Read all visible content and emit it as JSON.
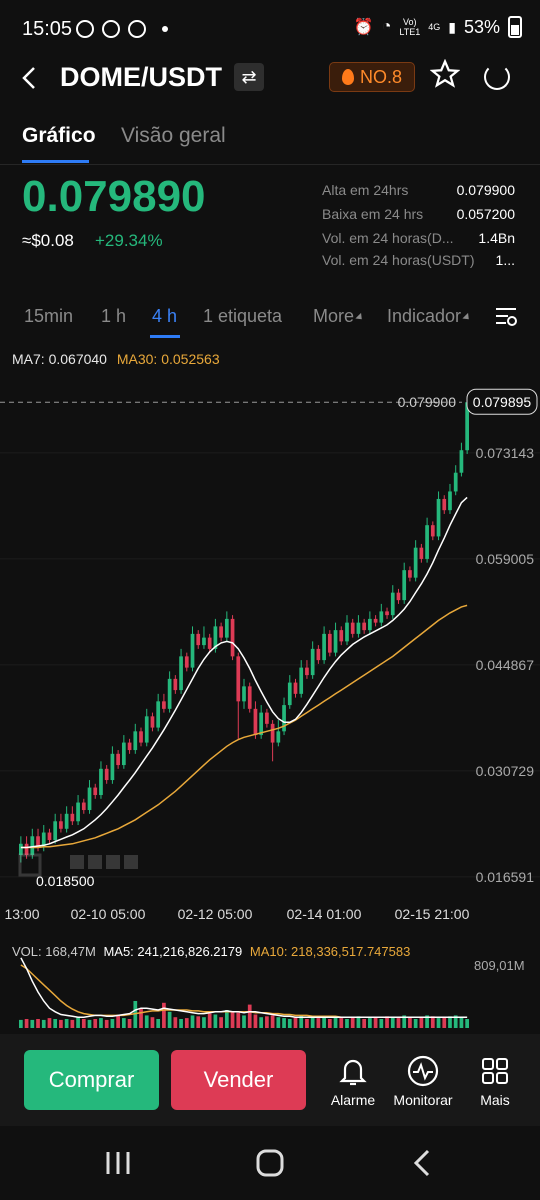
{
  "status": {
    "time": "15:05",
    "net_label_top": "Vo)",
    "net_label_bottom": "LTE1",
    "net_type": "4G",
    "battery": "53%"
  },
  "header": {
    "title": "DOME/USDT",
    "swap_icon": "swap-icon",
    "rank": "NO.8",
    "star_icon": "star-icon",
    "share_icon": "share-icon"
  },
  "tabs": [
    {
      "label": "Gráfico",
      "active": true
    },
    {
      "label": "Visão geral",
      "active": false
    }
  ],
  "price": {
    "last": "0.079890",
    "approx": "≈$0.08",
    "change": "+29.34%"
  },
  "stats": [
    {
      "label": "Alta em 24hrs",
      "value": "0.079900"
    },
    {
      "label": "Baixa em 24 hrs",
      "value": "0.057200"
    },
    {
      "label": "Vol. em 24 horas(D...",
      "value": "1.4Bn"
    },
    {
      "label": "Vol. em 24 horas(USDT)",
      "value": "1..."
    }
  ],
  "intervals": [
    {
      "label": "15min",
      "active": false
    },
    {
      "label": "1 h",
      "active": false
    },
    {
      "label": "4 h",
      "active": true
    },
    {
      "label": "1 etiqueta",
      "active": false
    },
    {
      "label": "More",
      "active": false
    },
    {
      "label": "Indicador",
      "active": false
    }
  ],
  "ma": {
    "ma7": "MA7: 0.067040",
    "ma30": "MA30: 0.052563"
  },
  "colors": {
    "up": "#25b87c",
    "down": "#dd3b55",
    "accent": "#2e7cf6",
    "ma7": "#ffffff",
    "ma30": "#e8a83a"
  },
  "chart_data": {
    "type": "candlestick",
    "y_ticks": [
      "0.073143",
      "0.059005",
      "0.044867",
      "0.030729",
      "0.016591"
    ],
    "x_ticks": [
      "13:00",
      "02-10 05:00",
      "02-12 05:00",
      "02-14 01:00",
      "02-15 21:00"
    ],
    "high_label": "0.079900",
    "low_label": "0.018500",
    "last_label": "0.079895",
    "ylim": [
      0.0155,
      0.081
    ],
    "candles": [
      [
        0.0195,
        0.021,
        0.022,
        0.0185
      ],
      [
        0.021,
        0.0195,
        0.022,
        0.019
      ],
      [
        0.0195,
        0.022,
        0.023,
        0.019
      ],
      [
        0.022,
        0.0205,
        0.023,
        0.02
      ],
      [
        0.0205,
        0.0225,
        0.0235,
        0.02
      ],
      [
        0.0225,
        0.0215,
        0.023,
        0.021
      ],
      [
        0.0215,
        0.024,
        0.025,
        0.021
      ],
      [
        0.024,
        0.023,
        0.025,
        0.0225
      ],
      [
        0.023,
        0.025,
        0.026,
        0.0225
      ],
      [
        0.025,
        0.024,
        0.026,
        0.0235
      ],
      [
        0.024,
        0.0265,
        0.0275,
        0.0235
      ],
      [
        0.0265,
        0.0255,
        0.027,
        0.025
      ],
      [
        0.0255,
        0.0285,
        0.0295,
        0.025
      ],
      [
        0.0285,
        0.0275,
        0.029,
        0.027
      ],
      [
        0.0275,
        0.031,
        0.032,
        0.027
      ],
      [
        0.031,
        0.0295,
        0.0315,
        0.029
      ],
      [
        0.0295,
        0.033,
        0.034,
        0.029
      ],
      [
        0.033,
        0.0315,
        0.0335,
        0.031
      ],
      [
        0.0315,
        0.0345,
        0.0355,
        0.031
      ],
      [
        0.0345,
        0.0335,
        0.035,
        0.033
      ],
      [
        0.0335,
        0.036,
        0.037,
        0.033
      ],
      [
        0.036,
        0.0345,
        0.0365,
        0.034
      ],
      [
        0.0345,
        0.038,
        0.039,
        0.034
      ],
      [
        0.038,
        0.0365,
        0.0385,
        0.036
      ],
      [
        0.0365,
        0.04,
        0.041,
        0.036
      ],
      [
        0.04,
        0.039,
        0.041,
        0.0385
      ],
      [
        0.039,
        0.043,
        0.044,
        0.0385
      ],
      [
        0.043,
        0.0415,
        0.0435,
        0.041
      ],
      [
        0.0415,
        0.046,
        0.047,
        0.041
      ],
      [
        0.046,
        0.0445,
        0.0465,
        0.044
      ],
      [
        0.0445,
        0.049,
        0.05,
        0.044
      ],
      [
        0.049,
        0.0475,
        0.0495,
        0.047
      ],
      [
        0.0475,
        0.0485,
        0.05,
        0.047
      ],
      [
        0.0485,
        0.047,
        0.049,
        0.0465
      ],
      [
        0.047,
        0.05,
        0.051,
        0.0465
      ],
      [
        0.05,
        0.0485,
        0.0505,
        0.048
      ],
      [
        0.0485,
        0.051,
        0.052,
        0.048
      ],
      [
        0.051,
        0.046,
        0.0515,
        0.0455
      ],
      [
        0.046,
        0.04,
        0.0465,
        0.035
      ],
      [
        0.04,
        0.042,
        0.043,
        0.039
      ],
      [
        0.042,
        0.039,
        0.0425,
        0.0385
      ],
      [
        0.039,
        0.0355,
        0.04,
        0.035
      ],
      [
        0.0355,
        0.0385,
        0.0395,
        0.035
      ],
      [
        0.0385,
        0.037,
        0.039,
        0.0365
      ],
      [
        0.037,
        0.0345,
        0.0375,
        0.032
      ],
      [
        0.0345,
        0.036,
        0.0375,
        0.034
      ],
      [
        0.036,
        0.0395,
        0.0405,
        0.0355
      ],
      [
        0.0395,
        0.0425,
        0.0435,
        0.039
      ],
      [
        0.0425,
        0.041,
        0.043,
        0.0405
      ],
      [
        0.041,
        0.0445,
        0.0455,
        0.0405
      ],
      [
        0.0445,
        0.0435,
        0.0455,
        0.043
      ],
      [
        0.0435,
        0.047,
        0.048,
        0.043
      ],
      [
        0.047,
        0.0455,
        0.0475,
        0.045
      ],
      [
        0.0455,
        0.049,
        0.05,
        0.045
      ],
      [
        0.049,
        0.0465,
        0.0495,
        0.046
      ],
      [
        0.0465,
        0.0495,
        0.0505,
        0.046
      ],
      [
        0.0495,
        0.048,
        0.05,
        0.0475
      ],
      [
        0.048,
        0.0505,
        0.0515,
        0.0475
      ],
      [
        0.0505,
        0.049,
        0.051,
        0.0485
      ],
      [
        0.049,
        0.0505,
        0.0515,
        0.0485
      ],
      [
        0.0505,
        0.0495,
        0.051,
        0.049
      ],
      [
        0.0495,
        0.051,
        0.052,
        0.049
      ],
      [
        0.051,
        0.0505,
        0.0515,
        0.05
      ],
      [
        0.0505,
        0.052,
        0.053,
        0.05
      ],
      [
        0.052,
        0.0515,
        0.0525,
        0.051
      ],
      [
        0.0515,
        0.0545,
        0.0555,
        0.051
      ],
      [
        0.0545,
        0.0535,
        0.055,
        0.053
      ],
      [
        0.0535,
        0.0575,
        0.0585,
        0.053
      ],
      [
        0.0575,
        0.0565,
        0.058,
        0.056
      ],
      [
        0.0565,
        0.0605,
        0.0615,
        0.056
      ],
      [
        0.0605,
        0.059,
        0.061,
        0.0585
      ],
      [
        0.059,
        0.0635,
        0.0645,
        0.0585
      ],
      [
        0.0635,
        0.062,
        0.064,
        0.0615
      ],
      [
        0.062,
        0.067,
        0.068,
        0.0615
      ],
      [
        0.067,
        0.0655,
        0.0675,
        0.065
      ],
      [
        0.0655,
        0.068,
        0.069,
        0.065
      ],
      [
        0.068,
        0.0705,
        0.0715,
        0.0675
      ],
      [
        0.0705,
        0.0735,
        0.0745,
        0.07
      ],
      [
        0.0735,
        0.0799,
        0.0799,
        0.073
      ]
    ],
    "ma7": [
      0.0205,
      0.0205,
      0.0206,
      0.0207,
      0.0208,
      0.021,
      0.0213,
      0.0216,
      0.0219,
      0.0222,
      0.0226,
      0.023,
      0.0236,
      0.0242,
      0.0249,
      0.0257,
      0.0266,
      0.0275,
      0.0285,
      0.0295,
      0.0305,
      0.0316,
      0.0327,
      0.0338,
      0.035,
      0.0362,
      0.0375,
      0.0388,
      0.0402,
      0.0416,
      0.043,
      0.0444,
      0.0456,
      0.0466,
      0.0473,
      0.0478,
      0.048,
      0.0478,
      0.047,
      0.0458,
      0.0444,
      0.0428,
      0.0413,
      0.0399,
      0.0386,
      0.0377,
      0.0372,
      0.0372,
      0.0376,
      0.0385,
      0.0396,
      0.0408,
      0.042,
      0.0432,
      0.0443,
      0.0453,
      0.0462,
      0.0469,
      0.0476,
      0.0481,
      0.0486,
      0.049,
      0.0494,
      0.0498,
      0.0502,
      0.0508,
      0.0515,
      0.0523,
      0.0533,
      0.0545,
      0.0557,
      0.057,
      0.0585,
      0.0602,
      0.0618,
      0.0635,
      0.065,
      0.0665,
      0.0672
    ],
    "ma30": [
      0.0205,
      0.0205,
      0.0205,
      0.0205,
      0.0206,
      0.0206,
      0.0207,
      0.0208,
      0.0209,
      0.021,
      0.0212,
      0.0214,
      0.0216,
      0.0218,
      0.0221,
      0.0224,
      0.0227,
      0.023,
      0.0234,
      0.0238,
      0.0242,
      0.0247,
      0.0252,
      0.0257,
      0.0262,
      0.0268,
      0.0274,
      0.028,
      0.0287,
      0.0294,
      0.0301,
      0.0308,
      0.0315,
      0.0322,
      0.0328,
      0.0334,
      0.034,
      0.0345,
      0.0349,
      0.0352,
      0.0354,
      0.0356,
      0.0358,
      0.036,
      0.0362,
      0.0364,
      0.0367,
      0.0371,
      0.0375,
      0.038,
      0.0385,
      0.039,
      0.0395,
      0.04,
      0.0405,
      0.041,
      0.0415,
      0.042,
      0.0425,
      0.043,
      0.0435,
      0.044,
      0.0445,
      0.045,
      0.0455,
      0.046,
      0.0466,
      0.0472,
      0.0478,
      0.0484,
      0.049,
      0.0496,
      0.0502,
      0.0508,
      0.0513,
      0.0518,
      0.0522,
      0.0526,
      0.0528
    ]
  },
  "volume": {
    "vol": "VOL: 168,47M",
    "ma5": "MA5: 241,216,826.2179",
    "ma10": "MA10: 218,336,517.747583",
    "max_label": "809,01M",
    "bars": [
      9,
      10,
      9,
      10,
      9,
      11,
      10,
      9,
      10,
      9,
      12,
      10,
      9,
      10,
      11,
      9,
      10,
      14,
      11,
      10,
      30,
      22,
      14,
      12,
      10,
      28,
      18,
      12,
      10,
      11,
      14,
      13,
      12,
      16,
      15,
      12,
      20,
      18,
      17,
      14,
      26,
      15,
      12,
      13,
      14,
      12,
      11,
      10,
      12,
      14,
      10,
      12,
      11,
      13,
      10,
      12,
      11,
      10,
      12,
      13,
      10,
      11,
      12,
      10,
      13,
      12,
      11,
      14,
      12,
      10,
      12,
      14,
      13,
      11,
      12,
      13,
      14,
      12,
      10
    ],
    "ma5_line": [
      78,
      66,
      52,
      40,
      30,
      22,
      18,
      15,
      14,
      13,
      12,
      12,
      13,
      14,
      14,
      13,
      13,
      14,
      15,
      16,
      20,
      22,
      22,
      21,
      20,
      22,
      21,
      20,
      19,
      18,
      17,
      16,
      16,
      17,
      18,
      18,
      19,
      18,
      18,
      17,
      18,
      18,
      17,
      16,
      15,
      14,
      13,
      13,
      12,
      12,
      12,
      12,
      12,
      12,
      12,
      12,
      12,
      12,
      12,
      12,
      12,
      12,
      12,
      12,
      12,
      12,
      12,
      12,
      12,
      12,
      12,
      12,
      12,
      12,
      12,
      12,
      12,
      12,
      12
    ],
    "ma10_line": [
      70,
      66,
      60,
      54,
      48,
      42,
      36,
      30,
      25,
      21,
      18,
      16,
      15,
      14,
      14,
      14,
      14,
      14,
      14,
      15,
      16,
      17,
      18,
      19,
      19,
      20,
      20,
      20,
      20,
      20,
      19,
      19,
      18,
      18,
      18,
      18,
      18,
      18,
      18,
      18,
      18,
      17,
      17,
      17,
      16,
      16,
      15,
      15,
      14,
      14,
      14,
      13,
      13,
      13,
      13,
      13,
      12,
      12,
      12,
      12,
      12,
      12,
      12,
      12,
      12,
      12,
      12,
      12,
      12,
      12,
      12,
      12,
      12,
      12,
      12,
      12,
      12,
      12,
      12
    ]
  },
  "actions": {
    "buy": "Comprar",
    "sell": "Vender",
    "alarm": "Alarme",
    "monitor": "Monitorar",
    "more": "Mais"
  }
}
